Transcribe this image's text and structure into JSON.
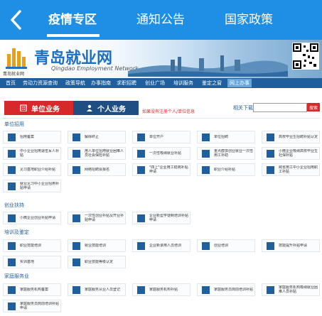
{
  "app": {
    "tabs": [
      {
        "label": "疫情专区"
      },
      {
        "label": "通知公告"
      },
      {
        "label": "国家政策"
      }
    ]
  },
  "banner": {
    "title": "青岛就业网",
    "subtitle": "Qingdao Employment Network",
    "logo_text": "青岛就业网"
  },
  "nav": {
    "items": [
      "首页",
      "劳动力资源查询",
      "政策导航",
      "办事指南",
      "求职招聘",
      "创业广场",
      "培训服务",
      "鉴定之窗",
      "网上办事"
    ]
  },
  "actions": {
    "unit_business": "单位业务",
    "personal_business": "个人业务",
    "hint": "如果没有注册个人/单位信息",
    "download_label": "相关下载",
    "search_label": "搜索"
  },
  "sections": {
    "danwei": {
      "title": "单位招用",
      "cards": [
        "招用备案",
        "解除终止",
        "单位开户",
        "单位招聘",
        "高校毕业生招聘补贴认定",
        "中小企业招用退伍军人补贴",
        "用人单位招用就业困难人员社会保险补贴",
        "一次性吸纳就业补贴",
        "重点群体创业就业一次性用工补助",
        "小微企业吸纳高校毕业生社保补贴",
        "见习基地职业介绍补贴",
        "网络招聘会报名",
        "\"四上\"企业用工稳岗补贴申请",
        "职业介绍补贴",
        "跨省用工中小企业招用职工补贴",
        "就业见习中小企业招用补贴申请"
      ]
    },
    "chuangye": {
      "title": "创业扶持",
      "cards": [
        "小微企业创业补贴申请",
        "一次性创业补贴及开业补贴申请",
        "企业新型学徒制培训补贴申请"
      ]
    },
    "peixun": {
      "title": "培训及鉴定",
      "cards": [
        "职业技能培训",
        "就业技能培训",
        "企业新录用人员培训",
        "创业培训",
        "技能提升补贴申请",
        "实训基地",
        "职业技能等级认定"
      ]
    },
    "jiating": {
      "title": "家庭服务业",
      "cards": [
        "家庭服务机构备案",
        "家庭服务从业人员登记",
        "家庭服务机构补贴",
        "家庭服务员岗前培训补贴",
        "家庭服务机构吸纳就业困难人员补贴",
        "家庭服务员岗前培训补贴申请"
      ]
    }
  }
}
